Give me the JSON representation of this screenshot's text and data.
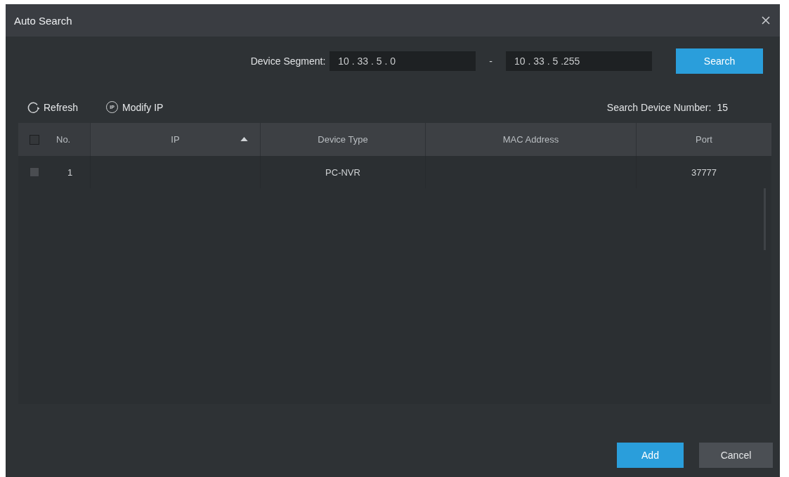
{
  "window": {
    "title": "Auto Search"
  },
  "segment": {
    "label": "Device Segment:",
    "start": "10 . 33 . 5 . 0",
    "separator": "-",
    "end": "10 . 33 . 5 .255",
    "button": "Search"
  },
  "toolbar": [
    {
      "kind": "refresh",
      "label": "Refresh"
    },
    {
      "kind": "modify-ip",
      "label": "Modify IP",
      "icon_text": "IP"
    }
  ],
  "device_count": {
    "label": "Search Device Number:",
    "value": "15"
  },
  "table": {
    "select_all_checked": false,
    "columns": [
      {
        "label": "No.",
        "sorted": false
      },
      {
        "label": "IP",
        "sorted": true
      },
      {
        "label": "Device Type",
        "sorted": false
      },
      {
        "label": "MAC Address",
        "sorted": false
      },
      {
        "label": "Port",
        "sorted": false
      }
    ],
    "rows": [
      {
        "checked": false,
        "cells": [
          "1",
          null,
          "PC-NVR",
          null,
          "37777"
        ]
      }
    ]
  },
  "buttons": [
    {
      "kind": "primary",
      "label": "Add"
    },
    {
      "kind": "secondary",
      "label": "Cancel"
    }
  ]
}
